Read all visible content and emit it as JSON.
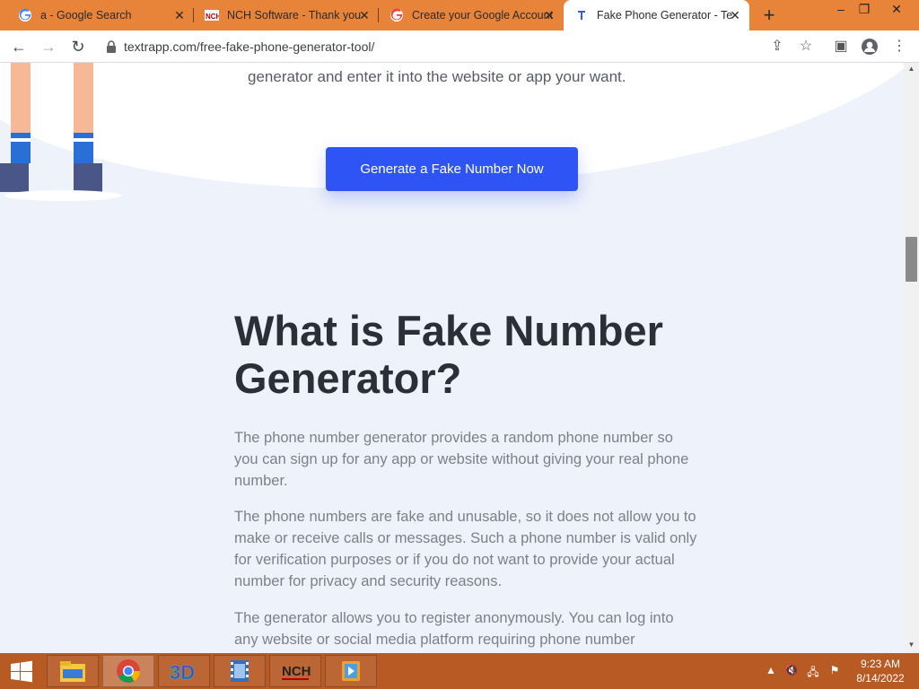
{
  "browser": {
    "tabs": [
      {
        "title": "a - Google Search",
        "icon": "google-icon"
      },
      {
        "title": "NCH Software - Thank you",
        "icon": "nch-icon"
      },
      {
        "title": "Create your Google Account",
        "icon": "google-icon"
      },
      {
        "title": "Fake Phone Generator - Te",
        "icon": "textrapp-icon",
        "active": true
      }
    ],
    "url": "textrapp.com/free-fake-phone-generator-tool/"
  },
  "page": {
    "intro_line": "generator and enter it into the website or app your want.",
    "cta_label": "Generate a Fake Number Now",
    "heading": "What is Fake Number Generator?",
    "paragraphs": [
      "The phone number generator provides a random phone number so you can sign up for any app or website without giving your real phone number.",
      "The phone numbers are fake and unusable, so it does not allow you to make or receive calls or messages. Such a phone number is valid only for verification purposes or if you do not want to provide your actual number for privacy and security reasons.",
      "The generator allows you to register anonymously. You can log into any website or social media platform requiring phone number"
    ]
  },
  "taskbar": {
    "apps": [
      "file-explorer-icon",
      "chrome-icon",
      "3d-app-icon",
      "video-editor-icon",
      "nch-software-icon",
      "media-player-icon"
    ],
    "time": "9:23 AM",
    "date": "8/14/2022"
  },
  "colors": {
    "tabstrip": "#e8833a",
    "cta": "#2f54f5",
    "page_bg": "#eef2fb",
    "taskbar": "#b85a24"
  }
}
